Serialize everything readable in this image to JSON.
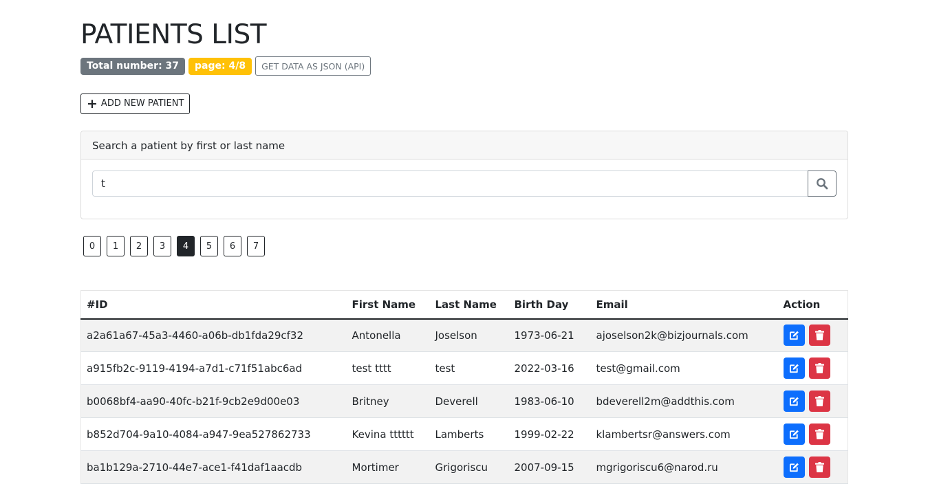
{
  "page_title": "PATIENTS LIST",
  "badges": {
    "total": "Total number: 37",
    "page": "page: 4/8"
  },
  "api_button_label": "GET DATA AS JSON (API)",
  "add_button_label": "ADD NEW PATIENT",
  "search": {
    "header": "Search a patient by first or last name",
    "value": "t",
    "placeholder": ""
  },
  "pagination": {
    "pages": [
      "0",
      "1",
      "2",
      "3",
      "4",
      "5",
      "6",
      "7"
    ],
    "active": "4"
  },
  "table": {
    "headers": {
      "id": "#ID",
      "first": "First Name",
      "last": "Last Name",
      "birth": "Birth Day",
      "email": "Email",
      "action": "Action"
    },
    "rows": [
      {
        "id": "a2a61a67-45a3-4460-a06b-db1fda29cf32",
        "first": "Antonella",
        "last": "Joselson",
        "birth": "1973-06-21",
        "email": "ajoselson2k@bizjournals.com"
      },
      {
        "id": "a915fb2c-9119-4194-a7d1-c71f51abc6ad",
        "first": "test tttt",
        "last": "test",
        "birth": "2022-03-16",
        "email": "test@gmail.com"
      },
      {
        "id": "b0068bf4-aa90-40fc-b21f-9cb2e9d00e03",
        "first": "Britney",
        "last": "Deverell",
        "birth": "1983-06-10",
        "email": "bdeverell2m@addthis.com"
      },
      {
        "id": "b852d704-9a10-4084-a947-9ea527862733",
        "first": "Kevina tttttt",
        "last": "Lamberts",
        "birth": "1999-02-22",
        "email": "klambertsr@answers.com"
      },
      {
        "id": "ba1b129a-2710-44e7-ace1-f41daf1aacdb",
        "first": "Mortimer",
        "last": "Grigoriscu",
        "birth": "2007-09-15",
        "email": "mgrigoriscu6@narod.ru"
      }
    ]
  },
  "icons": {
    "add": "plus-icon",
    "search": "search-icon",
    "edit": "edit-icon",
    "delete": "trash-icon"
  },
  "colors": {
    "total_badge": "#6c757d",
    "page_badge": "#ffc107",
    "edit_button": "#0d6efd",
    "delete_button": "#dc3545",
    "active_page": "#212529"
  }
}
